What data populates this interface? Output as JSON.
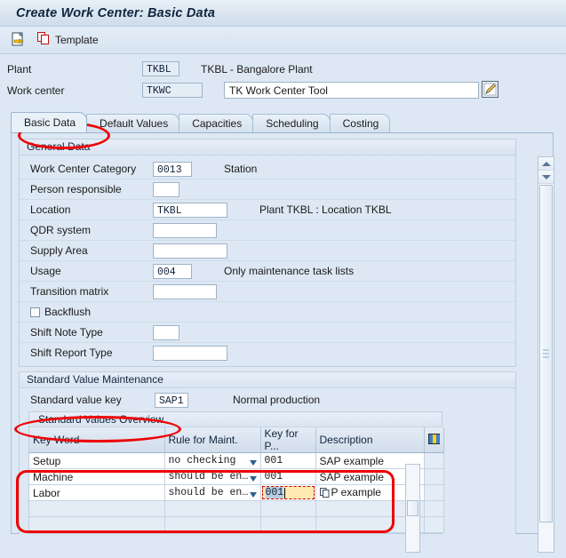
{
  "window": {
    "title": "Create Work Center: Basic Data"
  },
  "toolbar": {
    "items": [
      {
        "icon": "document-export-icon",
        "label": ""
      },
      {
        "icon": "copy-template-icon",
        "label": "Template"
      }
    ],
    "template_label": "Template"
  },
  "header": {
    "plant_label": "Plant",
    "plant_value": "TKBL",
    "plant_desc": "TKBL - Bangalore Plant",
    "workcenter_label": "Work center",
    "workcenter_value": "TKWC",
    "workcenter_desc": "TK Work Center Tool",
    "edit_icon": "pencil-edit-icon"
  },
  "tabs": [
    {
      "label": "Basic Data",
      "selected": true
    },
    {
      "label": "Default Values",
      "selected": false
    },
    {
      "label": "Capacities",
      "selected": false
    },
    {
      "label": "Scheduling",
      "selected": false
    },
    {
      "label": "Costing",
      "selected": false
    }
  ],
  "general_data": {
    "title": "General Data",
    "fields": [
      {
        "label": "Work Center Category",
        "value": "0013",
        "size": "sm",
        "desc": "Station"
      },
      {
        "label": "Person responsible",
        "value": "",
        "size": "tiny",
        "desc": ""
      },
      {
        "label": "Location",
        "value": "TKBL",
        "size": "lg",
        "desc": "Plant TKBL : Location TKBL"
      },
      {
        "label": "QDR system",
        "value": "",
        "size": "md",
        "desc": ""
      },
      {
        "label": "Supply Area",
        "value": "",
        "size": "lg",
        "desc": ""
      },
      {
        "label": "Usage",
        "value": "004",
        "size": "sm",
        "desc": "Only maintenance task lists"
      },
      {
        "label": "Transition matrix",
        "value": "",
        "size": "md",
        "desc": ""
      }
    ],
    "checkbox": {
      "label": "Backflush",
      "checked": false
    },
    "fields2": [
      {
        "label": "Shift Note Type",
        "value": "",
        "size": "tiny",
        "desc": ""
      },
      {
        "label": "Shift Report Type",
        "value": "",
        "size": "lg",
        "desc": ""
      }
    ]
  },
  "standard_value_maintenance": {
    "title": "Standard Value Maintenance",
    "key_label": "Standard value key",
    "key_value": "SAP1",
    "key_desc": "Normal production",
    "overview_title": "Standard Values Overview",
    "columns": [
      "Key Word",
      "Rule for Maint.",
      "Key for P...",
      "Description"
    ],
    "column_config_icon": "column-settings-icon",
    "rows": [
      {
        "key_word": "Setup",
        "rule": "no checking",
        "key_for_p": "001",
        "description": "SAP example"
      },
      {
        "key_word": "Machine",
        "rule": "should be en…",
        "key_for_p": "001",
        "description": "SAP example"
      },
      {
        "key_word": "Labor",
        "rule": "should be en…",
        "key_for_p": "001",
        "description": "P example"
      }
    ],
    "empty_rows": 2,
    "focused_cell": {
      "row": 2,
      "column": "key_for_p",
      "value": "001"
    },
    "focused_cell_icon": "copy-overlay-icon"
  },
  "colors": {
    "accent": "#ee0000",
    "panel_bg": "#dde8f4",
    "field_focus_bg": "#ffe9b0",
    "header_bg": "#d2ddeb"
  }
}
